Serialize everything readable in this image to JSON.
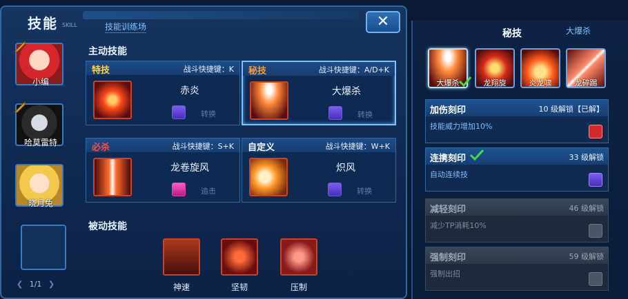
{
  "header": {
    "title": "技能",
    "title_sub": "SKILL",
    "tab_training": "技能训练场",
    "close": "✕"
  },
  "characters": [
    {
      "name": "小编"
    },
    {
      "name": "哈莫雷特"
    },
    {
      "name": "晓月兔"
    }
  ],
  "pager": {
    "text": "1/1"
  },
  "active": {
    "label": "主动技能",
    "cards": [
      {
        "category": "特技",
        "category_color": "#ffd54a",
        "shortcut": "战斗快捷键：K",
        "skill": "赤炎",
        "action": "转换"
      },
      {
        "category": "秘技",
        "category_color": "#ff9b2e",
        "shortcut": "战斗快捷键：A/D+K",
        "skill": "大爆杀",
        "action": "转换"
      },
      {
        "category": "必杀",
        "category_color": "#ff4a4a",
        "shortcut": "战斗快捷键：S+K",
        "skill": "龙卷旋风",
        "action": "追击"
      },
      {
        "category": "自定义",
        "category_color": "#ffffff",
        "shortcut": "战斗快捷键：W+K",
        "skill": "炽风",
        "action": "转换"
      }
    ]
  },
  "passive": {
    "label": "被动技能",
    "skills": [
      {
        "name": "神速"
      },
      {
        "name": "坚韧"
      },
      {
        "name": "压制"
      }
    ]
  },
  "right": {
    "title": "秘技",
    "subtitle": "大爆杀",
    "skills": [
      {
        "name": "大爆杀"
      },
      {
        "name": "龙翔旋"
      },
      {
        "name": "炎龙啸"
      },
      {
        "name": "龙碎踢"
      }
    ],
    "inscriptions": [
      {
        "name": "加伤刻印",
        "unlock": "10 级解锁【已解】",
        "desc": "技能威力增加10%"
      },
      {
        "name": "连携刻印",
        "unlock": "33 级解锁",
        "desc": "自动连续技"
      },
      {
        "name": "减轻刻印",
        "unlock": "46 级解锁",
        "desc": "减少TP消耗10%"
      },
      {
        "name": "强制刻印",
        "unlock": "59 级解锁",
        "desc": "强制出招"
      }
    ]
  }
}
